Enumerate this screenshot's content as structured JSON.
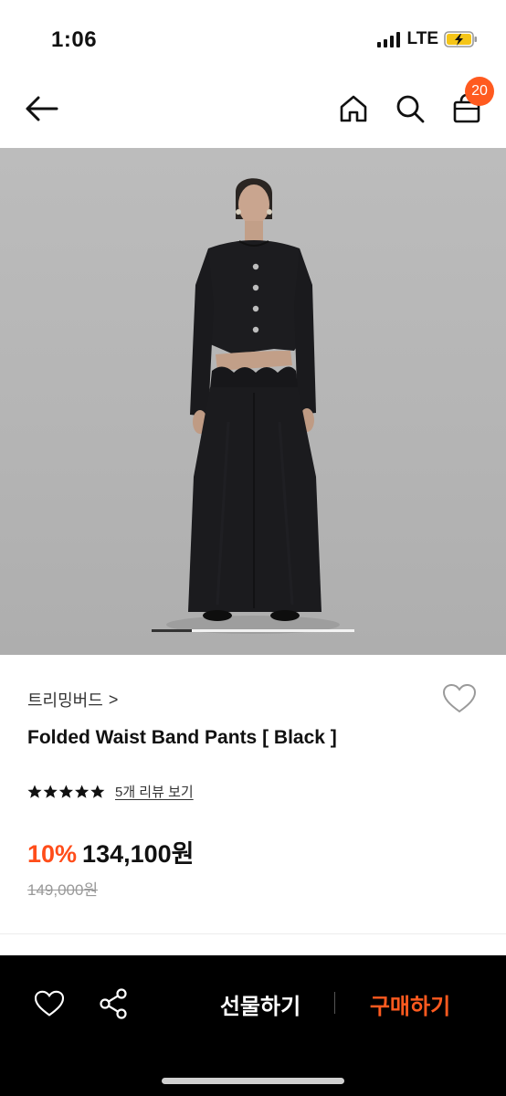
{
  "status_bar": {
    "time": "1:06",
    "network": "LTE",
    "battery_icon": "battery-charging-icon",
    "battery_color": "#f5c518"
  },
  "nav": {
    "back_icon": "back-arrow-icon",
    "home_icon": "home-icon",
    "search_icon": "search-icon",
    "cart_icon": "shopping-bag-icon",
    "cart_count": "20",
    "badge_color": "#ff5a1f"
  },
  "hero": {
    "image": "product-photo-model-in-black-jacket-and-wide-pants",
    "slide_index": 1,
    "slide_progress": 0.2
  },
  "product": {
    "brand": "트리밍버드",
    "brand_chevron": ">",
    "title": "Folded Waist Band Pants [ Black ]",
    "rating_stars": 5,
    "review_link": "5개 리뷰 보기",
    "discount": "10%",
    "price": "134,100원",
    "original_price": "149,000원",
    "accent_color": "#ff4d1a"
  },
  "bottom_bar": {
    "wish_icon": "heart-icon",
    "share_icon": "share-icon",
    "gift_label": "선물하기",
    "buy_label": "구매하기",
    "buy_color": "#ff5a1f"
  }
}
